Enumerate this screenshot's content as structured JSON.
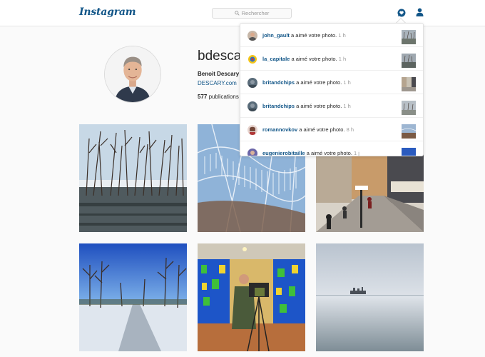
{
  "header": {
    "logo": "Instagram",
    "search_placeholder": "Rechercher"
  },
  "profile": {
    "username": "bdescary",
    "fullname": "Benoit Descary",
    "website": "DESCARY.com",
    "publications_count": "577",
    "publications_label": "publications"
  },
  "notifications": [
    {
      "user": "john_gault",
      "action": "a aimé votre photo.",
      "time": "1 h"
    },
    {
      "user": "la_capitale",
      "action": "a aimé votre photo.",
      "time": "1 h"
    },
    {
      "user": "britandchips",
      "action": "a aimé votre photo.",
      "time": "1 h"
    },
    {
      "user": "britandchips",
      "action": "a aimé votre photo.",
      "time": "1 h"
    },
    {
      "user": "romannovkov",
      "action": "a aimé votre photo.",
      "time": "8 h"
    },
    {
      "user": "eugenierobitaille",
      "action": "a aimé votre photo.",
      "time": "1 j"
    }
  ],
  "colors": {
    "link_blue": "#125688",
    "border": "#dbdbdb",
    "background": "#fafafa"
  },
  "icons": {
    "search": "search-icon",
    "notifications": "heart-bubble-icon",
    "profile": "user-icon"
  }
}
